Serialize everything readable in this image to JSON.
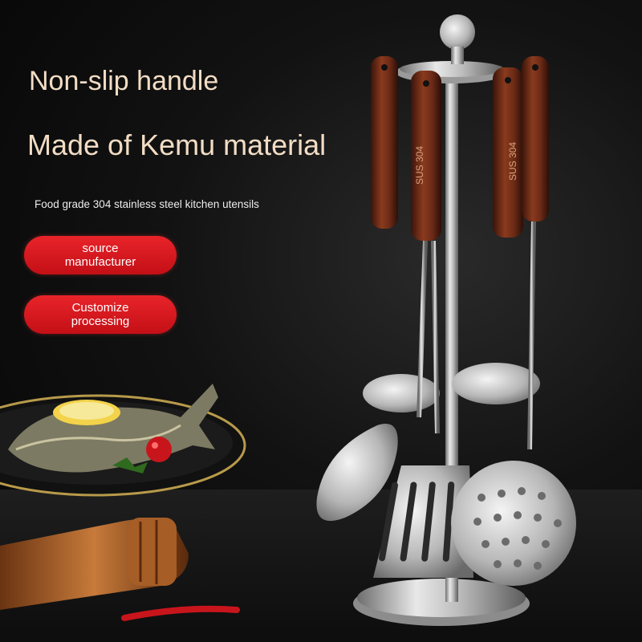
{
  "headlines": {
    "line1": "Non-slip handle",
    "line2": "Made of Kemu material"
  },
  "subtitle": "Food grade 304 stainless steel kitchen utensils",
  "badges": [
    {
      "line1": "source",
      "line2": "manufacturer"
    },
    {
      "line1": "Customize",
      "line2": "processing"
    }
  ],
  "handle_engraving": "SUS 304",
  "colors": {
    "headline": "#f2dcc4",
    "badge_red": "#d9161d",
    "background": "#0b0b0b",
    "wood_handle": "#6b2a16",
    "steel": "#c8c8c8"
  }
}
